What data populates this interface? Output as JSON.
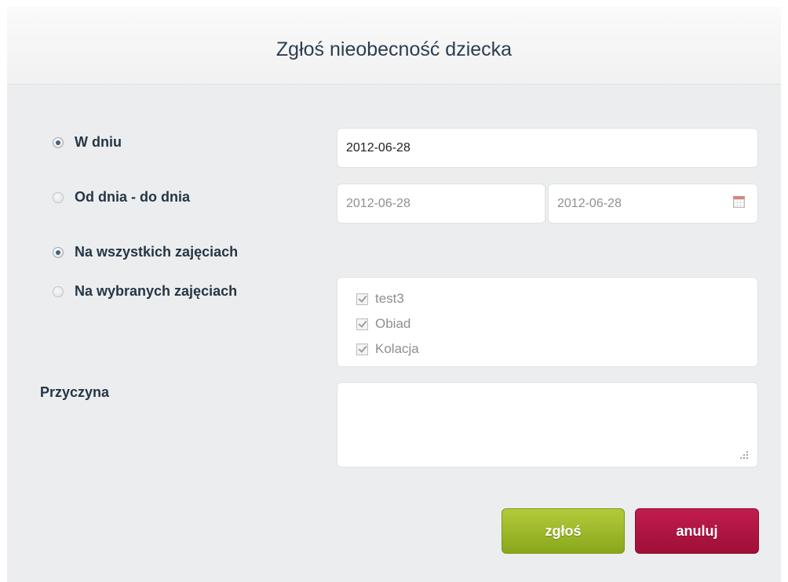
{
  "dialog": {
    "title": "Zgłoś nieobecność dziecka"
  },
  "date_mode": {
    "single_label": "W dniu",
    "single_selected": true,
    "single_date": "2012-06-28",
    "range_label": "Od dnia - do dnia",
    "range_selected": false,
    "range_from": "2012-06-28",
    "range_to": "2012-06-28"
  },
  "activities": {
    "all_label": "Na wszystkich zajęciach",
    "all_selected": true,
    "selected_label": "Na wybranych zajęciach",
    "selected_selected": false,
    "items": [
      {
        "label": "test3",
        "checked": true
      },
      {
        "label": "Obiad",
        "checked": true
      },
      {
        "label": "Kolacja",
        "checked": true
      }
    ]
  },
  "reason": {
    "label": "Przyczyna",
    "value": ""
  },
  "buttons": {
    "submit_label": "zgłoś",
    "cancel_label": "anuluj"
  },
  "colors": {
    "submit": "#9bb82a",
    "cancel": "#b0164a",
    "title": "#2c3e50"
  },
  "icons": {
    "calendar": "calendar-icon",
    "resize": "resize-grip-icon"
  }
}
